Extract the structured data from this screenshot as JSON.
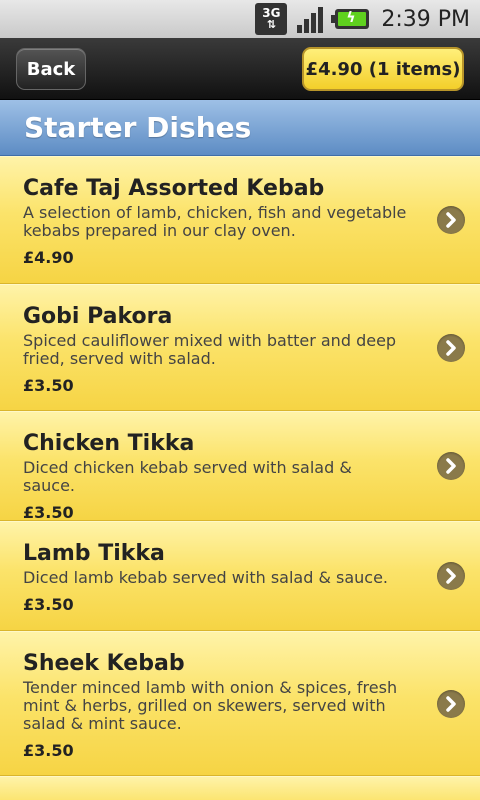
{
  "status_bar": {
    "network": "3G",
    "time": "2:39 PM"
  },
  "toolbar": {
    "back_label": "Back",
    "cart_label": "£4.90 (1 items)"
  },
  "section": {
    "title": "Starter Dishes"
  },
  "items": [
    {
      "name": "Cafe Taj Assorted Kebab",
      "description": "A selection of lamb, chicken, fish and vegetable kebabs prepared in our clay oven.",
      "price": "£4.90"
    },
    {
      "name": "Gobi Pakora",
      "description": "Spiced cauliflower mixed with batter and deep fried, served with salad.",
      "price": "£3.50"
    },
    {
      "name": "Chicken Tikka",
      "description": "Diced chicken kebab served with salad & sauce.",
      "price": "£3.50"
    },
    {
      "name": "Lamb Tikka",
      "description": "Diced lamb kebab served with salad & sauce.",
      "price": "£3.50"
    },
    {
      "name": "Sheek Kebab",
      "description": "Tender minced lamb with onion & spices, fresh mint & herbs, grilled on skewers, served with salad & mint sauce.",
      "price": "£3.50"
    }
  ],
  "icons": {
    "item_chevron": "chevron-right-icon"
  }
}
